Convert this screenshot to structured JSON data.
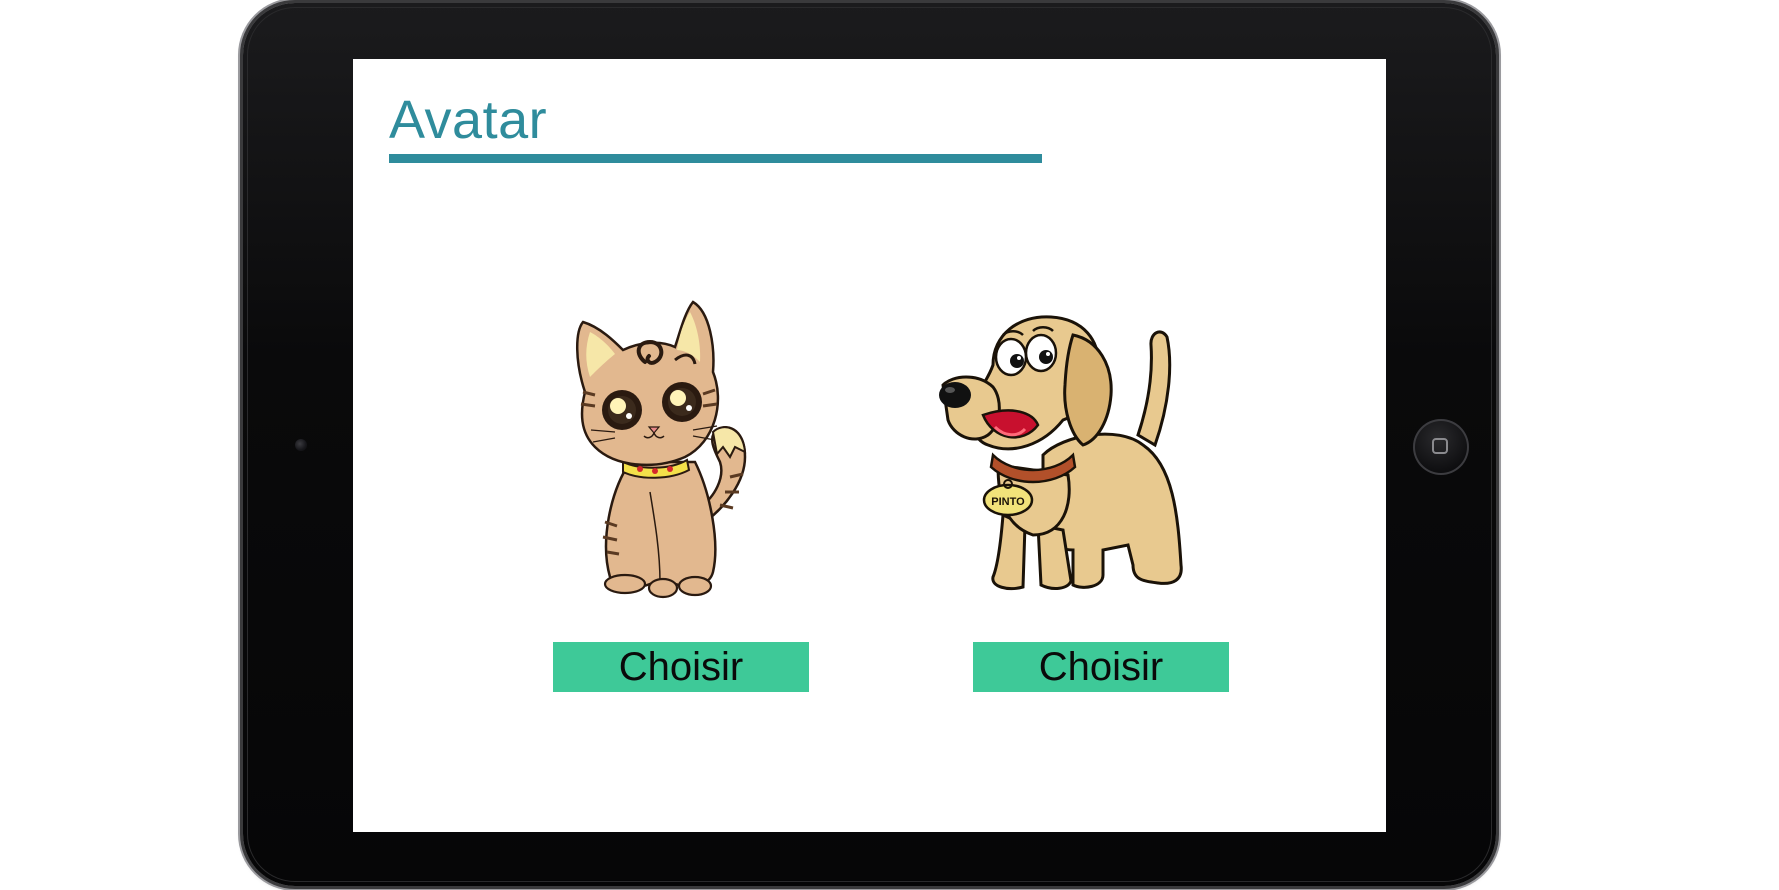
{
  "page": {
    "title": "Avatar"
  },
  "avatars": [
    {
      "id": "cat",
      "icon": "cat-avatar-icon",
      "button_label": "Choisir"
    },
    {
      "id": "dog",
      "icon": "dog-avatar-icon",
      "button_label": "Choisir",
      "tag_text": "PINTO"
    }
  ],
  "colors": {
    "title": "#2f8c9c",
    "underline": "#2f8c9c",
    "button_bg": "#3ec998",
    "button_text": "#0a0a0a",
    "device_frame": "#0a0a0b",
    "screen_bg": "#ffffff"
  }
}
